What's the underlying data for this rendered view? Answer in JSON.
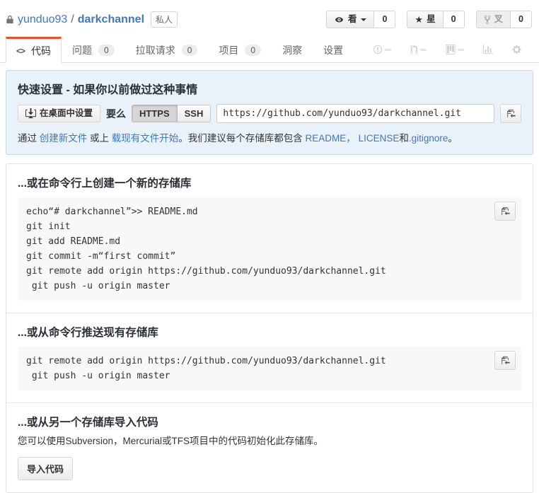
{
  "header": {
    "owner": "yunduo93",
    "path_separator": "/",
    "repo": "darkchannel",
    "private_badge": "私人",
    "watch_label": "看",
    "watch_count": "0",
    "star_label": "星",
    "star_count": "0",
    "fork_label": "叉",
    "fork_count": "0"
  },
  "tabs": {
    "code": "代码",
    "issues": "问题",
    "issues_count": "0",
    "pulls": "拉取请求",
    "pulls_count": "0",
    "projects": "项目",
    "projects_count": "0",
    "insights": "洞察",
    "settings": "设置"
  },
  "quick_setup": {
    "title": "快速设置 - 如果你以前做过这种事情",
    "desktop_button": "在桌面中设置",
    "or_label": "要么",
    "https_label": "HTTPS",
    "ssh_label": "SSH",
    "clone_url": "https://github.com/yunduo93/darkchannel.git",
    "hint_prefix": "通过 ",
    "hint_link_new_file": "创建新文件",
    "hint_middle": " 或上 ",
    "hint_link_upload": "载现有文件开始",
    "hint_suggest": "。我们建议每个存储库都包含 ",
    "hint_link_readme": "README，",
    "hint_space": " ",
    "hint_link_license": "LICENSE",
    "hint_and": "和",
    "hint_link_gitignore": ".gitignore",
    "hint_end": "。"
  },
  "section_create": {
    "title": "...或在命令行上创建一个新的存储库",
    "code": "echo“# darkchannel”>> README.md\ngit init\ngit add README.md\ngit commit -m“first commit”\ngit remote add origin https://github.com/yunduo93/darkchannel.git\n git push -u origin master"
  },
  "section_push": {
    "title": "...或从命令行推送现有存储库",
    "code": "git remote add origin https://github.com/yunduo93/darkchannel.git\n git push -u origin master"
  },
  "section_import": {
    "title": "...或从另一个存储库导入代码",
    "description": "您可以使用Subversion，Mercurial或TFS项目中的代码初始化此存储库。",
    "button": "导入代码"
  },
  "colors": {
    "link_blue": "#4078c0",
    "active_tab_accent": "#e5532c",
    "quick_setup_bg": "#e9f2f9"
  }
}
